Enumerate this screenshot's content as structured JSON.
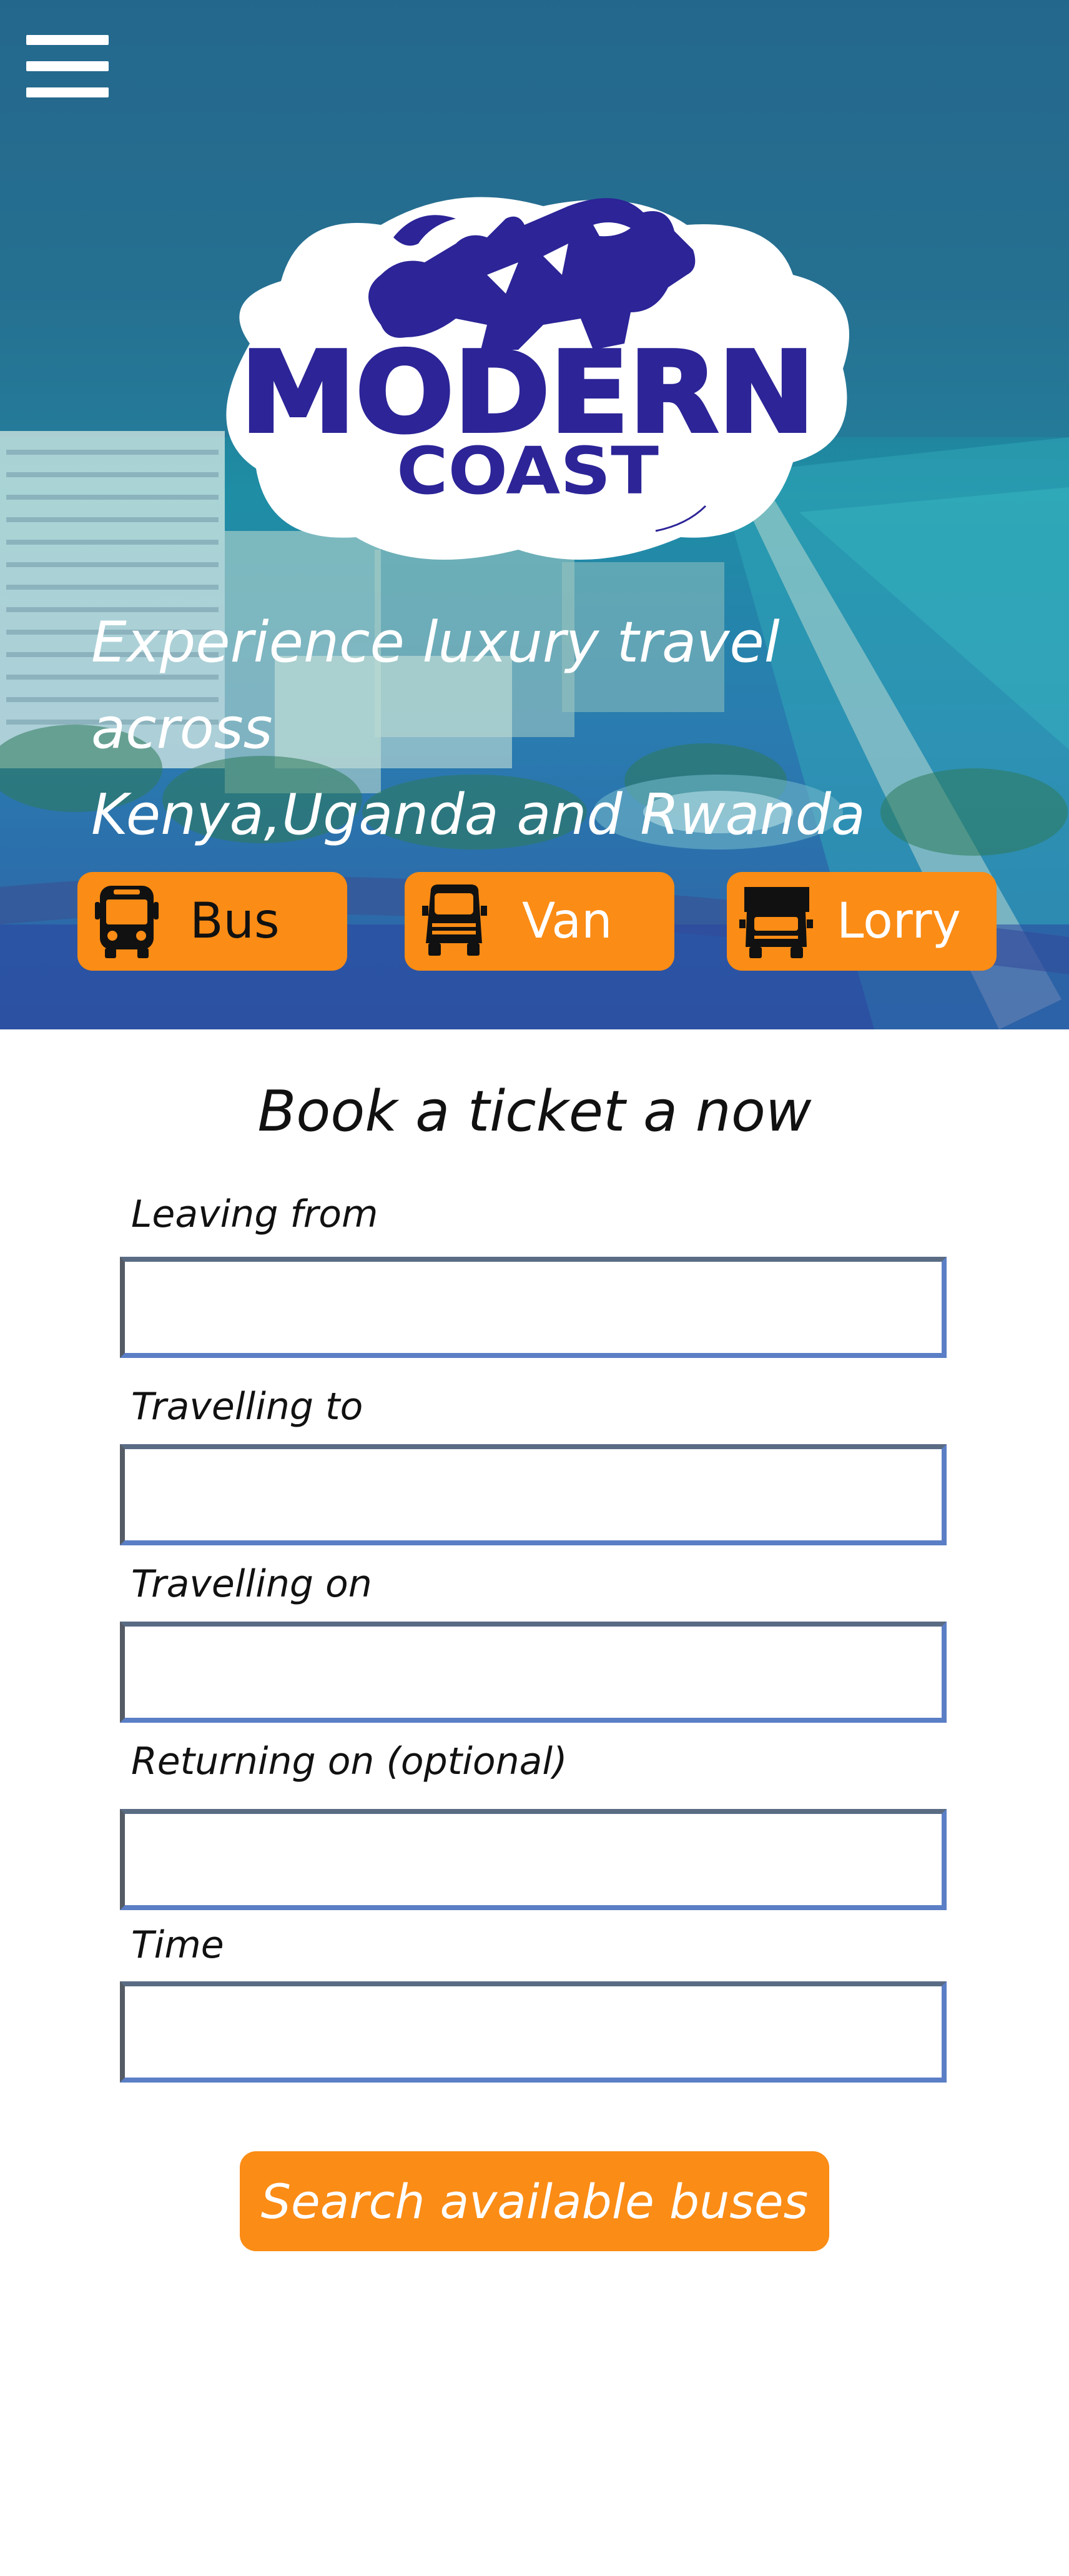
{
  "header": {
    "menu_icon": "hamburger-menu-icon",
    "logo_alt": "Modern Coast logo"
  },
  "hero": {
    "tagline_line1": "Experience luxury travel across",
    "tagline_line2": "Kenya,Uganda and Rwanda",
    "vehicle_tabs": [
      {
        "label": "Bus",
        "icon": "bus-icon"
      },
      {
        "label": "Van",
        "icon": "van-icon"
      },
      {
        "label": "Lorry",
        "icon": "lorry-icon"
      }
    ]
  },
  "booking": {
    "title": "Book a ticket a now",
    "fields": [
      {
        "label": "Leaving from",
        "value": "",
        "placeholder": ""
      },
      {
        "label": "Travelling to",
        "value": "",
        "placeholder": ""
      },
      {
        "label": "Travelling on",
        "value": "",
        "placeholder": ""
      },
      {
        "label": "Returning on (optional)",
        "value": "",
        "placeholder": ""
      },
      {
        "label": "Time",
        "value": "",
        "placeholder": ""
      }
    ],
    "submit_label": "Search available buses"
  },
  "colors": {
    "accent": "#fb8c15",
    "logo_blue": "#2c2497",
    "text": "#111111"
  }
}
